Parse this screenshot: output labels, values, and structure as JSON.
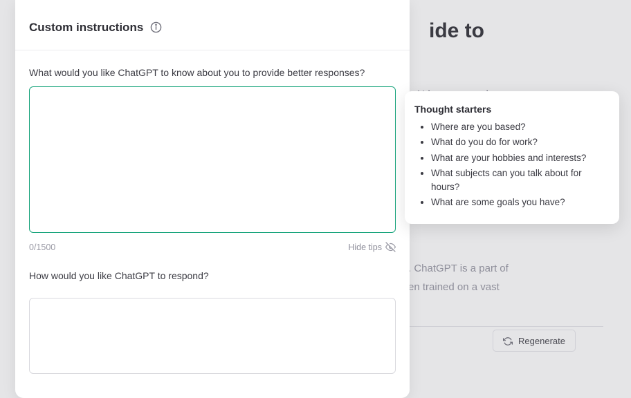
{
  "background": {
    "title_fragment": "ide to",
    "text1": "AI has emerged as a",
    "text2_line1": ". ChatGPT is a part of",
    "text2_line2": "en trained on a vast",
    "regenerate_label": "Regenerate"
  },
  "modal": {
    "title": "Custom instructions",
    "field1_label": "What would you like ChatGPT to know about you to provide better responses?",
    "char_count": "0/1500",
    "hide_tips_label": "Hide tips",
    "field2_label": "How would you like ChatGPT to respond?"
  },
  "tooltip": {
    "title": "Thought starters",
    "items": [
      "Where are you based?",
      "What do you do for work?",
      "What are your hobbies and interests?",
      "What subjects can you talk about for hours?",
      "What are some goals you have?"
    ]
  }
}
